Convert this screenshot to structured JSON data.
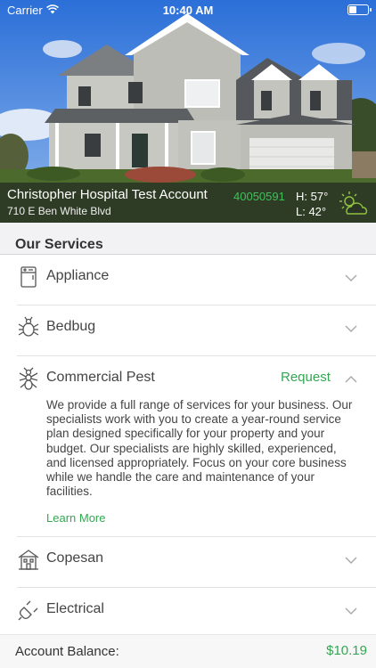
{
  "status_bar": {
    "carrier": "Carrier",
    "time": "10:40 AM"
  },
  "account": {
    "name": "Christopher Hospital Test Account",
    "address": "710 E Ben White Blvd",
    "number": "40050591",
    "weather": {
      "high": "H:  57°",
      "low": "L:   42°",
      "icon": "partly-cloudy-icon"
    }
  },
  "services": {
    "header": "Our Services",
    "items": [
      {
        "label": "Appliance",
        "icon": "appliance-icon",
        "expanded": false
      },
      {
        "label": "Bedbug",
        "icon": "bedbug-icon",
        "expanded": false
      },
      {
        "label": "Commercial Pest",
        "icon": "ant-icon",
        "expanded": true,
        "action": "Request",
        "description": "We provide a full range of services for your business. Our specialists work with you to create a year-round service plan designed specifically for your property and your budget.  Our specialists are highly skilled, experienced, and licensed appropriately. Focus on your core business while we handle the care and maintenance of your facilities.",
        "link": "Learn More"
      },
      {
        "label": "Copesan",
        "icon": "building-icon",
        "expanded": false
      },
      {
        "label": "Electrical",
        "icon": "plug-icon",
        "expanded": false
      }
    ]
  },
  "balance": {
    "label": "Account Balance:",
    "value": "$10.19"
  },
  "colors": {
    "accent": "#33a852",
    "account_number": "#3ec15a",
    "header_bg": "#f2f2f4"
  }
}
